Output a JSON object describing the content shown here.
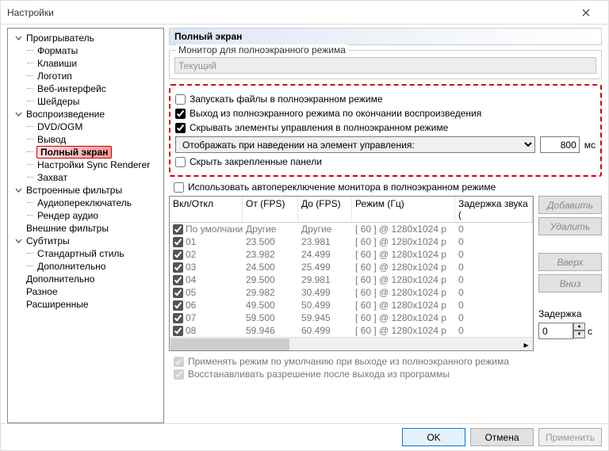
{
  "window": {
    "title": "Настройки"
  },
  "tree": [
    {
      "label": "Проигрыватель",
      "lvl": 1,
      "expand": "open"
    },
    {
      "label": "Форматы",
      "lvl": 2
    },
    {
      "label": "Клавиши",
      "lvl": 2
    },
    {
      "label": "Логотип",
      "lvl": 2
    },
    {
      "label": "Веб-интерфейс",
      "lvl": 2
    },
    {
      "label": "Шейдеры",
      "lvl": 2
    },
    {
      "label": "Воспроизведение",
      "lvl": 1,
      "expand": "open"
    },
    {
      "label": "DVD/OGM",
      "lvl": 2
    },
    {
      "label": "Вывод",
      "lvl": 2
    },
    {
      "label": "Полный экран",
      "lvl": 2,
      "selected": true
    },
    {
      "label": "Настройки Sync Renderer",
      "lvl": 2
    },
    {
      "label": "Захват",
      "lvl": 2
    },
    {
      "label": "Встроенные фильтры",
      "lvl": 1,
      "expand": "open"
    },
    {
      "label": "Аудиопереключатель",
      "lvl": 2
    },
    {
      "label": "Рендер аудио",
      "lvl": 2
    },
    {
      "label": "Внешние фильтры",
      "lvl": 1,
      "expand": "none"
    },
    {
      "label": "Субтитры",
      "lvl": 1,
      "expand": "open"
    },
    {
      "label": "Стандартный стиль",
      "lvl": 2
    },
    {
      "label": "Дополнительно",
      "lvl": 2
    },
    {
      "label": "Дополнительно",
      "lvl": 1,
      "expand": "none"
    },
    {
      "label": "Разное",
      "lvl": 1,
      "expand": "none"
    },
    {
      "label": "Расширенные",
      "lvl": 1,
      "expand": "none"
    }
  ],
  "panel": {
    "title": "Полный экран",
    "monitor_group": "Монитор для полноэкранного режима",
    "monitor_value": "Текущий",
    "chk_launch": {
      "label": "Запускать файлы в полноэкранном режиме",
      "checked": false
    },
    "chk_exit": {
      "label": "Выход из полноэкранного режима по окончании воспроизведения",
      "checked": true
    },
    "chk_hide": {
      "label": "Скрывать элементы управления в полноэкранном режиме",
      "checked": true
    },
    "hover_select": "Отображать при наведении на элемент управления:",
    "hover_ms": "800",
    "ms_label": "мс",
    "chk_pin": {
      "label": "Скрыть закрепленные панели",
      "checked": false
    },
    "chk_autoswitch": {
      "label": "Использовать автопереключение монитора в полноэкранном режиме",
      "checked": false
    },
    "table": {
      "headers": {
        "c1": "Вкл/Откл",
        "c2": "От (FPS)",
        "c3": "До (FPS)",
        "c4": "Режим (Гц)",
        "c5": "Задержка звука ("
      },
      "rows": [
        {
          "name": "По умолчанию",
          "from": "Другие",
          "to": "Другие",
          "mode": "[ 60 ] @ 1280x1024 p",
          "delay": "0",
          "chk": true
        },
        {
          "name": "01",
          "from": "23.500",
          "to": "23.981",
          "mode": "[ 60 ] @ 1280x1024 p",
          "delay": "0",
          "chk": true
        },
        {
          "name": "02",
          "from": "23.982",
          "to": "24.499",
          "mode": "[ 60 ] @ 1280x1024 p",
          "delay": "0",
          "chk": true
        },
        {
          "name": "03",
          "from": "24.500",
          "to": "25.499",
          "mode": "[ 60 ] @ 1280x1024 p",
          "delay": "0",
          "chk": true
        },
        {
          "name": "04",
          "from": "29.500",
          "to": "29.981",
          "mode": "[ 60 ] @ 1280x1024 p",
          "delay": "0",
          "chk": true
        },
        {
          "name": "05",
          "from": "29.982",
          "to": "30.499",
          "mode": "[ 60 ] @ 1280x1024 p",
          "delay": "0",
          "chk": true
        },
        {
          "name": "06",
          "from": "49.500",
          "to": "50.499",
          "mode": "[ 60 ] @ 1280x1024 p",
          "delay": "0",
          "chk": true
        },
        {
          "name": "07",
          "from": "59.500",
          "to": "59.945",
          "mode": "[ 60 ] @ 1280x1024 p",
          "delay": "0",
          "chk": true
        },
        {
          "name": "08",
          "from": "59.946",
          "to": "60.499",
          "mode": "[ 60 ] @ 1280x1024 p",
          "delay": "0",
          "chk": true
        }
      ]
    },
    "btn_add": "Добавить",
    "btn_del": "Удалить",
    "btn_up": "Вверх",
    "btn_down": "Вниз",
    "delay_label": "Задержка",
    "delay_value": "0",
    "delay_unit": "с",
    "chk_apply_default": {
      "label": "Применять режим по умолчанию при выходе из полноэкранного режима",
      "checked": true
    },
    "chk_restore": {
      "label": "Восстанавливать разрешение после выхода из программы",
      "checked": true
    }
  },
  "footer": {
    "ok": "OK",
    "cancel": "Отмена",
    "apply": "Применить"
  }
}
